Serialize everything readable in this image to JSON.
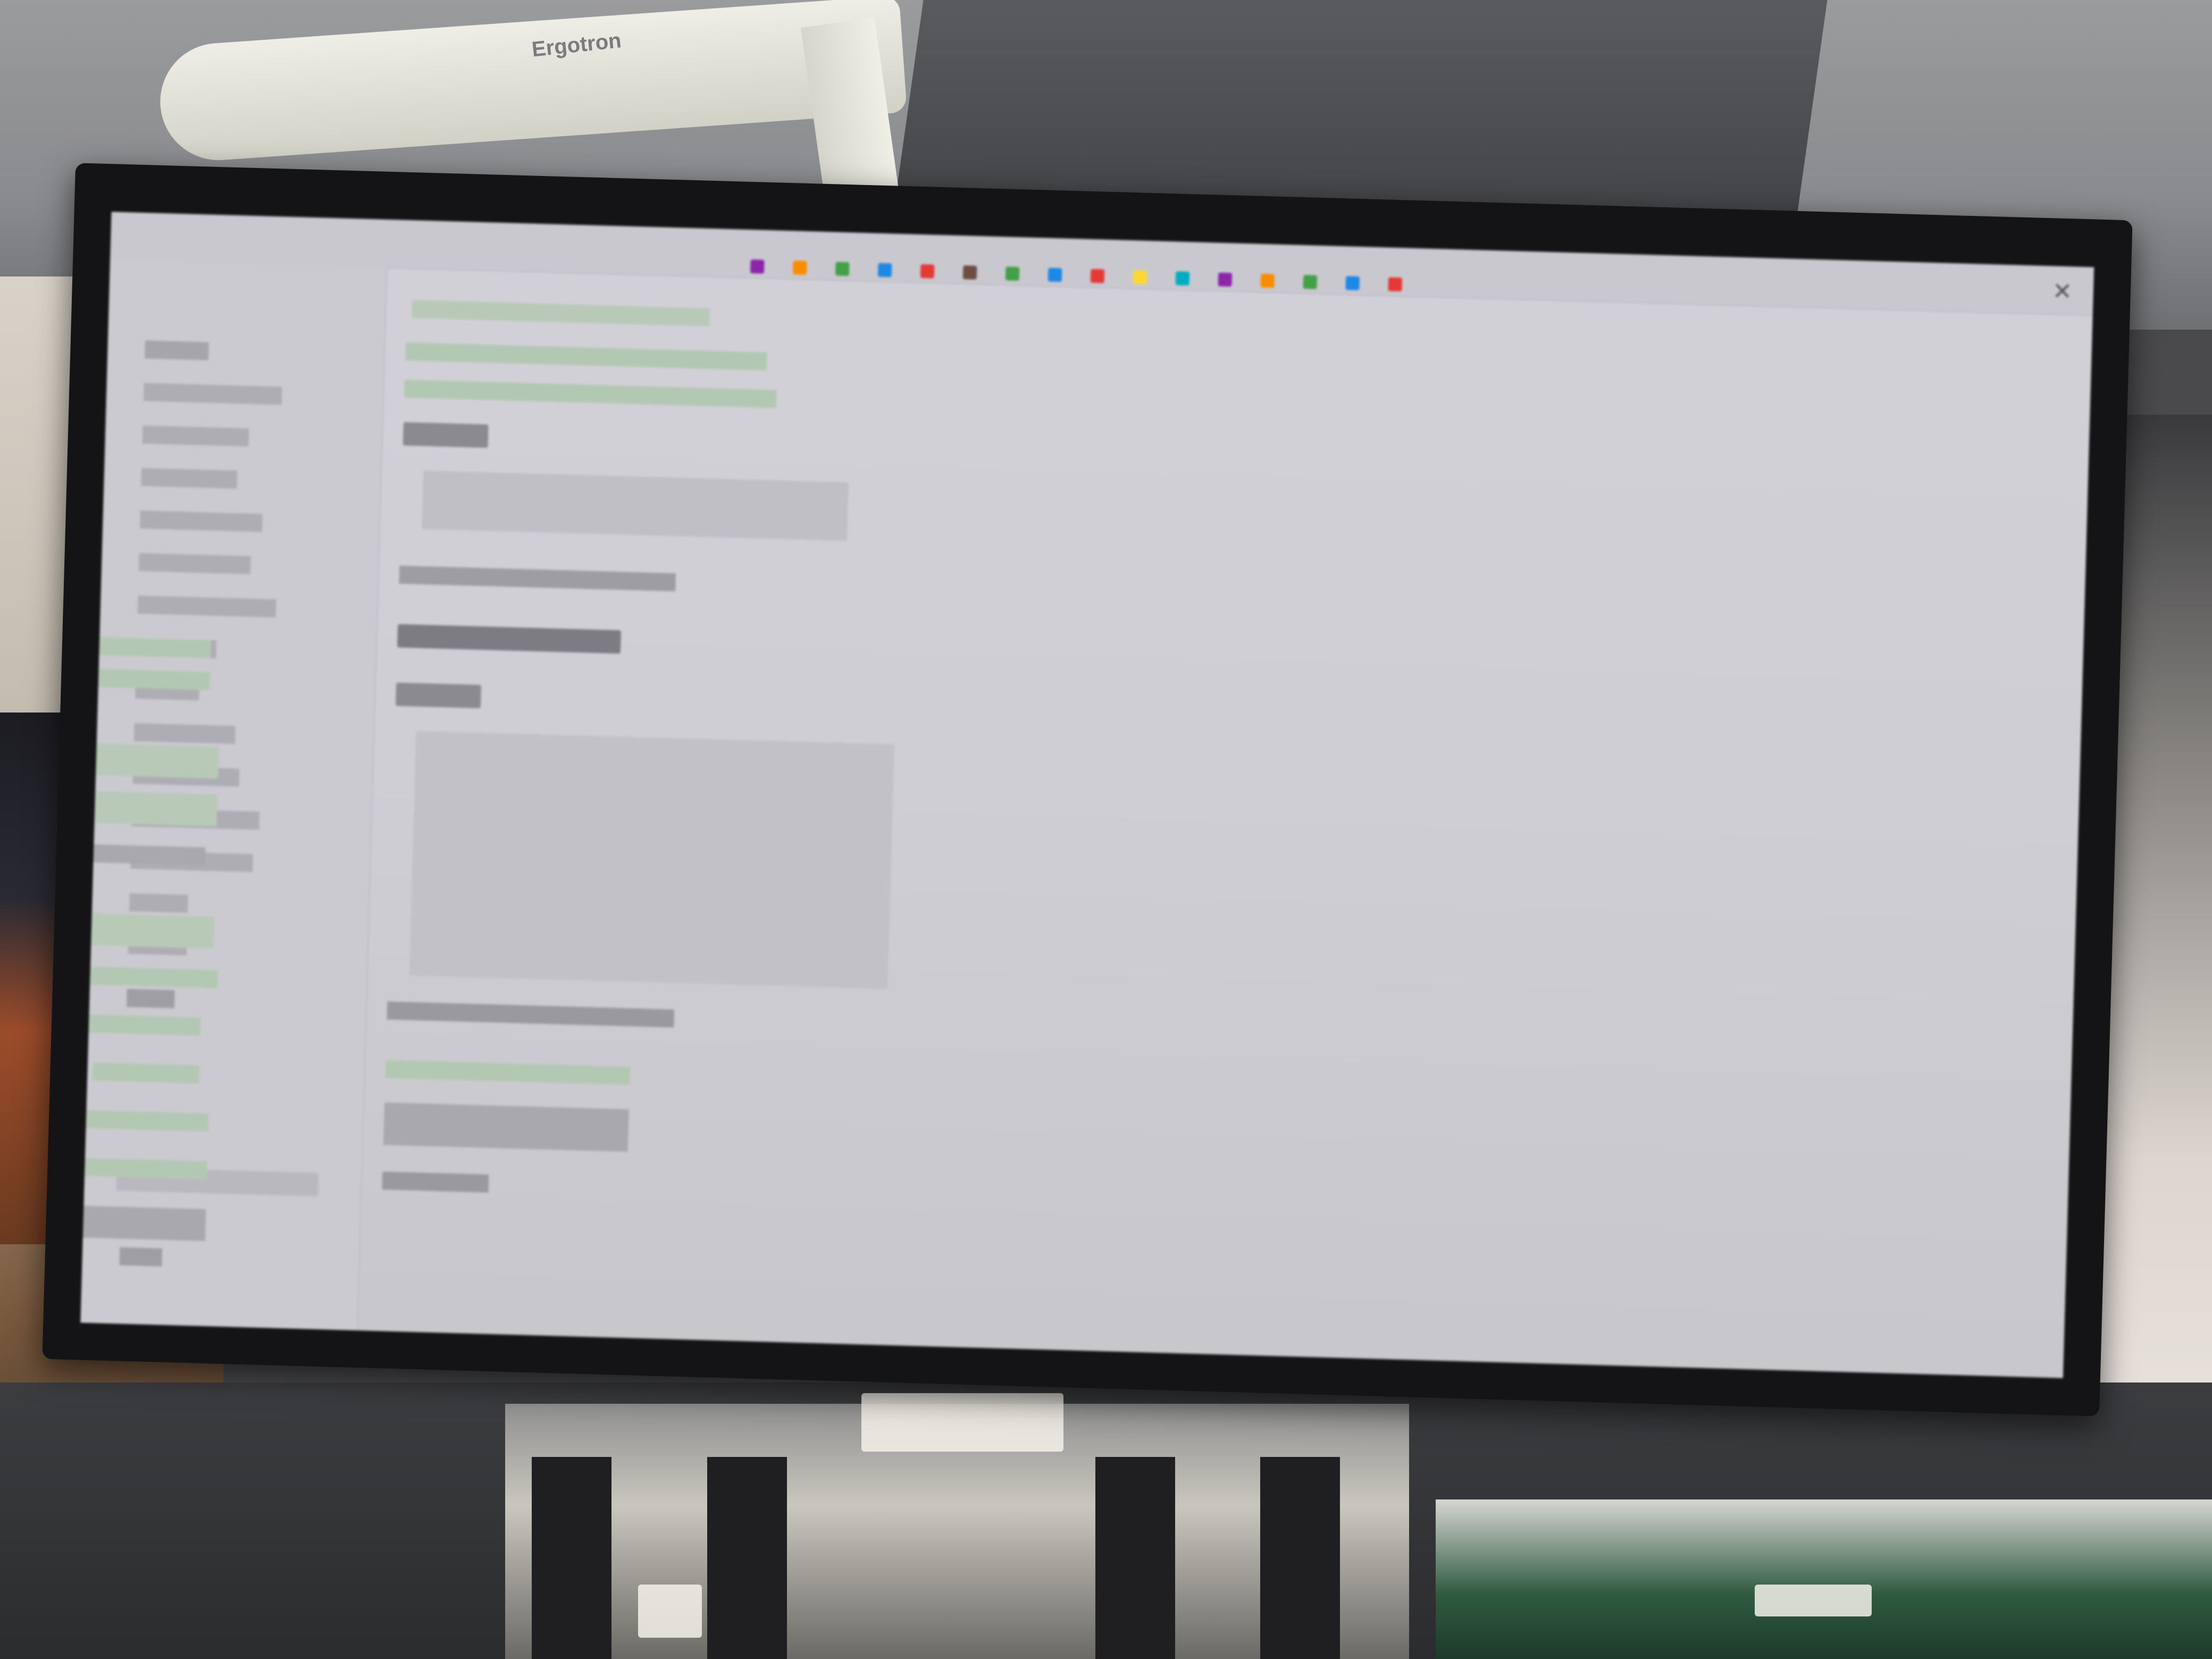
{
  "scene": {
    "description_visible_text": {
      "arm_logo": "Ergotron"
    }
  },
  "screen": {
    "note": "",
    "toolbar_colors": [
      "#e53935",
      "#1e88e5",
      "#43a047",
      "#fb8c00",
      "#8e24aa",
      "#00acc1",
      "#fdd835",
      "#6d4c41"
    ]
  }
}
